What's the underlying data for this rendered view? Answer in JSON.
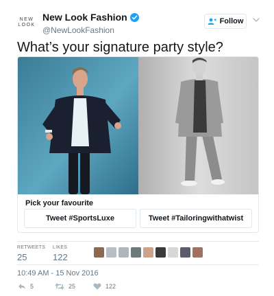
{
  "account": {
    "avatar_line1": "NEW",
    "avatar_line2": "LOOK",
    "display_name": "New Look Fashion",
    "handle": "@NewLookFashion",
    "verified": true
  },
  "follow_button": {
    "label": "Follow",
    "icon": "add-user-icon"
  },
  "tweet": {
    "text": "What’s your signature party style?"
  },
  "poll": {
    "prompt": "Pick your favourite",
    "choices": [
      "Tweet #SportsLuxe",
      "Tweet #Tailoringwithatwist"
    ]
  },
  "stats": {
    "retweets_label": "RETWEETS",
    "retweets_value": "25",
    "likes_label": "LIKES",
    "likes_value": "122"
  },
  "timestamp": "10:49 AM - 15 Nov 2016",
  "actions": {
    "reply_count": "5",
    "retweet_count": "25",
    "like_count": "122"
  },
  "colors": {
    "accent": "#1da1f2",
    "muted": "#657786",
    "border": "#e1e8ed"
  }
}
